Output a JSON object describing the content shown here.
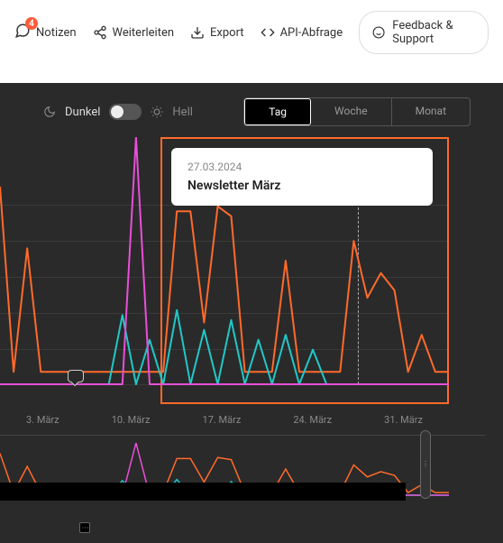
{
  "toolbar": {
    "notes": {
      "label": "Notizen",
      "badge": "4"
    },
    "forward": {
      "label": "Weiterleiten"
    },
    "export": {
      "label": "Export"
    },
    "api": {
      "label": "API-Abfrage"
    },
    "feedback": {
      "label": "Feedback & Support"
    }
  },
  "theme": {
    "dark_label": "Dunkel",
    "light_label": "Hell"
  },
  "range_tabs": {
    "day": "Tag",
    "week": "Woche",
    "month": "Monat",
    "active": "Tag"
  },
  "tooltip": {
    "date": "27.03.2024",
    "title": "Newsletter März"
  },
  "colors": {
    "orange": "#ff6a2b",
    "cyan": "#22c7c7",
    "magenta": "#e84fd8"
  },
  "chart_data": {
    "type": "line",
    "xlabel": "",
    "ylabel": "",
    "x_ticks": [
      "3. März",
      "10. März",
      "17. März",
      "24. März",
      "31. März"
    ],
    "marker_date": "27.03.2024",
    "series": [
      {
        "name": "orange",
        "color": "#ff6a2b",
        "values": [
          80,
          5,
          55,
          5,
          5,
          5,
          5,
          5,
          5,
          5,
          5,
          5,
          5,
          70,
          70,
          25,
          72,
          68,
          5,
          5,
          5,
          50,
          5,
          5,
          5,
          5,
          58,
          35,
          45,
          38,
          5,
          20,
          5,
          5
        ]
      },
      {
        "name": "cyan",
        "color": "#22c7c7",
        "values": [
          0,
          0,
          0,
          0,
          0,
          0,
          0,
          0,
          0,
          28,
          0,
          18,
          0,
          30,
          0,
          22,
          0,
          26,
          0,
          18,
          0,
          20,
          0,
          14,
          0,
          0,
          0,
          0,
          0,
          0,
          0,
          0,
          0,
          0
        ]
      },
      {
        "name": "magenta",
        "color": "#e84fd8",
        "values": [
          0,
          0,
          0,
          0,
          0,
          0,
          0,
          0,
          0,
          0,
          100,
          0,
          0,
          0,
          0,
          0,
          0,
          0,
          0,
          0,
          0,
          0,
          0,
          0,
          0,
          0,
          0,
          0,
          0,
          0,
          0,
          0,
          0,
          0
        ]
      }
    ],
    "ylim": [
      0,
      100
    ]
  }
}
